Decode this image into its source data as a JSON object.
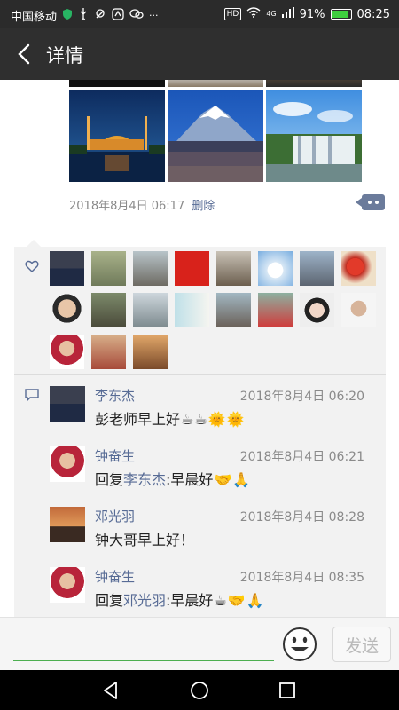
{
  "status_bar": {
    "carrier": "中国移动",
    "battery_percent": "91%",
    "battery_level": 0.91,
    "time": "08:25",
    "network": "4G",
    "hd": "HD",
    "more": "···"
  },
  "header": {
    "title": "详情"
  },
  "post": {
    "timestamp": "2018年8月4日 06:17",
    "delete_label": "删除"
  },
  "comments": [
    {
      "name": "李东杰",
      "time": "2018年8月4日 06:20",
      "text": "彭老师早上好",
      "emoji": [
        "☕",
        "☕",
        "🌞",
        "🌞"
      ]
    },
    {
      "name": "钟奋生",
      "time": "2018年8月4日 06:21",
      "reply_prefix": "回复",
      "reply_to": "李东杰",
      "text": ":早晨好",
      "emoji": [
        "🤝",
        "🙏"
      ]
    },
    {
      "name": "邓光羽",
      "time": "2018年8月4日 08:28",
      "text": "钟大哥早上好！",
      "emoji": []
    },
    {
      "name": "钟奋生",
      "time": "2018年8月4日 08:35",
      "reply_prefix": "回复",
      "reply_to": "邓光羽",
      "text": ":早晨好",
      "emoji": [
        "☕",
        "🤝",
        "🙏"
      ]
    }
  ],
  "input_bar": {
    "placeholder": "",
    "send_label": "发送"
  },
  "colors": {
    "link_blue": "#576b95",
    "title_bar": "#2f2f2f",
    "input_underline": "#4caf50"
  }
}
